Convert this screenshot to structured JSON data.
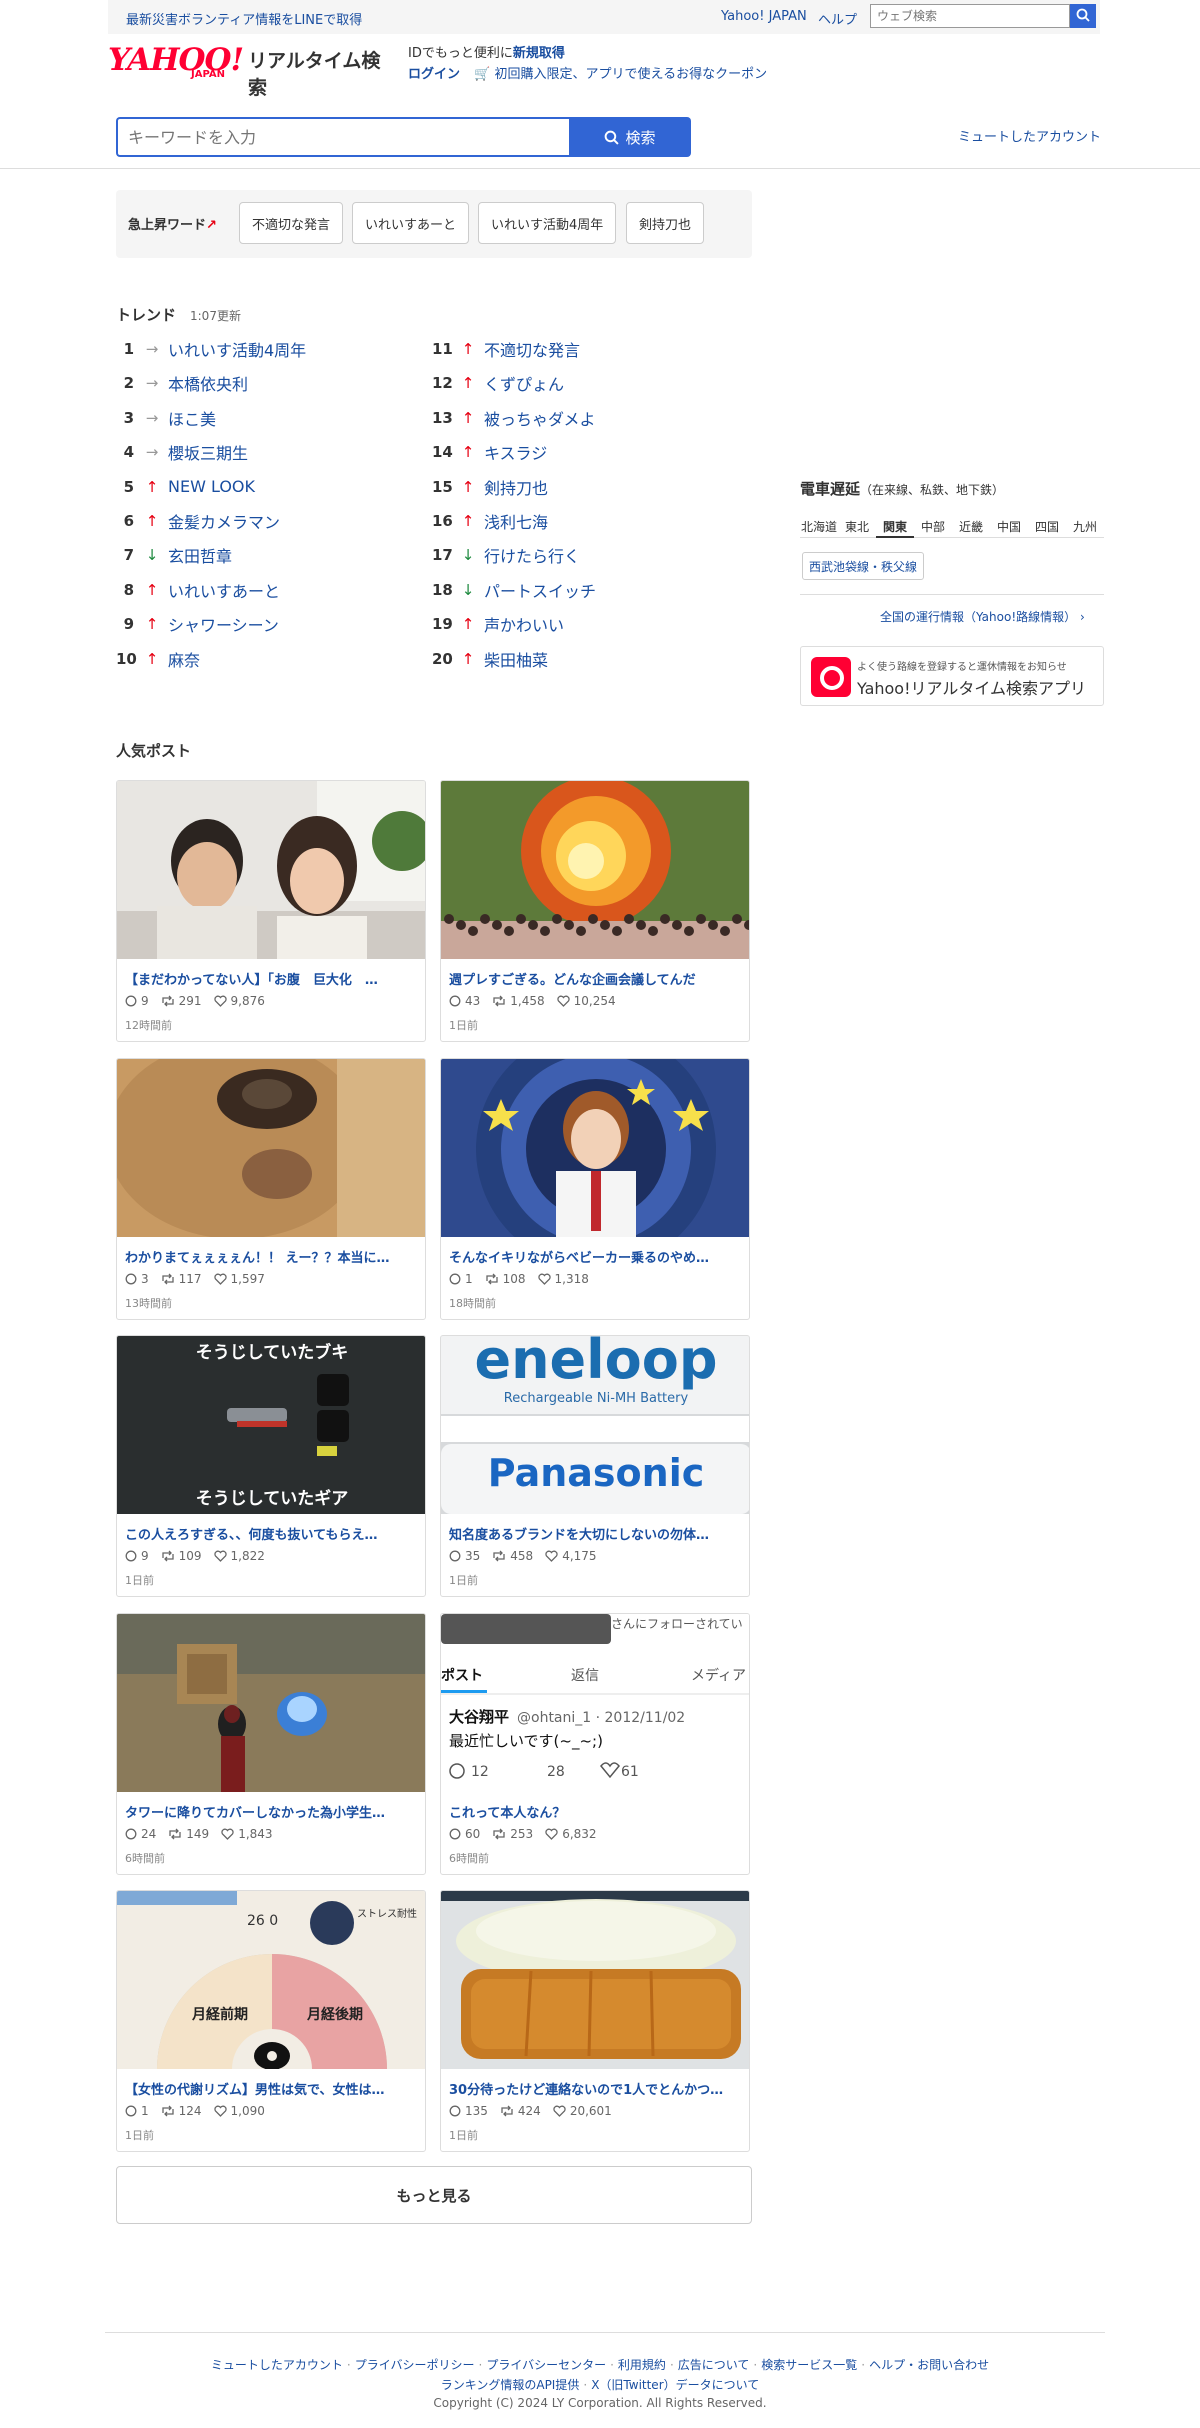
{
  "topbar": {
    "promo": "最新災害ボランティア情報をLINEで取得",
    "yahoo_japan": "Yahoo! JAPAN",
    "help": "ヘルプ",
    "web_search_placeholder": "ウェブ検索"
  },
  "header": {
    "logo_text": "YAHOO!",
    "logo_sub": "JAPAN",
    "service_name": "リアルタイム検索",
    "id_line_prefix": "IDでもっと便利に",
    "id_line_link": "新規取得",
    "login": "ログイン",
    "coupon": "初回購入限定、アプリで使えるお得なクーポン"
  },
  "search": {
    "placeholder": "キーワードを入力",
    "button": "検索",
    "muted_accounts": "ミュートしたアカウント"
  },
  "rising": {
    "label": "急上昇ワード",
    "words": [
      "不適切な発言",
      "いれいすあーと",
      "いれいす活動4周年",
      "剣持刀也"
    ]
  },
  "trend": {
    "title": "トレンド",
    "updated": "1:07更新",
    "items": [
      {
        "rank": "1",
        "dir": "flat",
        "word": "いれいす活動4周年"
      },
      {
        "rank": "2",
        "dir": "flat",
        "word": "本橋依央利"
      },
      {
        "rank": "3",
        "dir": "flat",
        "word": "ほこ美"
      },
      {
        "rank": "4",
        "dir": "flat",
        "word": "櫻坂三期生"
      },
      {
        "rank": "5",
        "dir": "up",
        "word": "NEW LOOK"
      },
      {
        "rank": "6",
        "dir": "up",
        "word": "金髪カメラマン"
      },
      {
        "rank": "7",
        "dir": "down",
        "word": "玄田哲章"
      },
      {
        "rank": "8",
        "dir": "up",
        "word": "いれいすあーと"
      },
      {
        "rank": "9",
        "dir": "up",
        "word": "シャワーシーン"
      },
      {
        "rank": "10",
        "dir": "up",
        "word": "麻奈"
      },
      {
        "rank": "11",
        "dir": "up",
        "word": "不適切な発言"
      },
      {
        "rank": "12",
        "dir": "up",
        "word": "くずぴょん"
      },
      {
        "rank": "13",
        "dir": "up",
        "word": "被っちゃダメよ"
      },
      {
        "rank": "14",
        "dir": "up",
        "word": "キスラジ"
      },
      {
        "rank": "15",
        "dir": "up",
        "word": "剣持刀也"
      },
      {
        "rank": "16",
        "dir": "up",
        "word": "浅利七海"
      },
      {
        "rank": "17",
        "dir": "down",
        "word": "行けたら行く"
      },
      {
        "rank": "18",
        "dir": "down",
        "word": "パートスイッチ"
      },
      {
        "rank": "19",
        "dir": "up",
        "word": "声かわいい"
      },
      {
        "rank": "20",
        "dir": "up",
        "word": "柴田柚菜"
      }
    ]
  },
  "train": {
    "title": "電車遅延",
    "subtitle": "（在来線、私鉄、地下鉄）",
    "regions": [
      "北海道",
      "東北",
      "関東",
      "中部",
      "近畿",
      "中国",
      "四国",
      "九州"
    ],
    "active_region": "関東",
    "line": "西武池袋線・秩父線",
    "nationwide": "全国の運行情報（Yahoo!路線情報） ›"
  },
  "app_banner": {
    "small": "よく使う路線を登録すると運休情報をお知らせ",
    "big": "Yahoo!リアルタイム検索アプリ"
  },
  "posts": {
    "title": "人気ポスト",
    "items": [
      {
        "title": "【まだわかってない人】「お腹　巨大化　…",
        "replies": "9",
        "reposts": "291",
        "likes": "9,876",
        "time": "12時間前",
        "img": "couple"
      },
      {
        "title": "週プレすごぎる。どんな企画会議してんだ",
        "replies": "43",
        "reposts": "1,458",
        "likes": "10,254",
        "time": "1日前",
        "img": "explosion"
      },
      {
        "title": "わかりまてぇぇぇぇん！！ えー？？本当に…",
        "replies": "3",
        "reposts": "117",
        "likes": "1,597",
        "time": "13時間前",
        "img": "dog"
      },
      {
        "title": "そんなイキリながらベビーカー乗るのやめ…",
        "replies": "1",
        "reposts": "108",
        "likes": "1,318",
        "time": "18時間前",
        "img": "anime"
      },
      {
        "title": "この人えろすぎる、、何度も抜いてもらえ…",
        "replies": "9",
        "reposts": "109",
        "likes": "1,822",
        "time": "1日前",
        "img": "game"
      },
      {
        "title": "知名度あるブランドを大切にしないの勿体…",
        "replies": "35",
        "reposts": "458",
        "likes": "4,175",
        "time": "1日前",
        "img": "battery"
      },
      {
        "title": "タワーに降りてカバーしなかった為小学生…",
        "replies": "24",
        "reposts": "149",
        "likes": "1,843",
        "time": "6時間前",
        "img": "fps"
      },
      {
        "title": "これって本人なん？",
        "replies": "60",
        "reposts": "253",
        "likes": "6,832",
        "time": "6時間前",
        "img": "tweet"
      },
      {
        "title": "【女性の代謝リズム】男性は気で、女性は…",
        "replies": "1",
        "reposts": "124",
        "likes": "1,090",
        "time": "1日前",
        "img": "rhythm"
      },
      {
        "title": "30分待ったけど連絡ないので1人でとんかつ…",
        "replies": "135",
        "reposts": "424",
        "likes": "20,601",
        "time": "1日前",
        "img": "tonkatsu"
      }
    ],
    "image_texts": {
      "game_top": "そうじしていたブキ",
      "game_bottom": "そうじしていたギア",
      "battery_brand": "eneloop",
      "battery_sub": "Rechargeable Ni-MH Battery",
      "battery_maker": "Panasonic",
      "tweet_follow": "さんにフォローされてい",
      "tweet_tab_post": "ポスト",
      "tweet_tab_reply": "返信",
      "tweet_tab_media": "メディア",
      "tweet_name": "大谷翔平",
      "tweet_handle": "@ohtani_1 · 2012/11/02",
      "tweet_text": "最近忙しいです(~_~;)",
      "tweet_r": "12",
      "tweet_rt": "28",
      "tweet_l": "61",
      "rhythm_top": "26 0",
      "rhythm_stress": "ストレス耐性",
      "rhythm_left1": "月経前期",
      "rhythm_left2": "月経後期"
    },
    "more": "もっと見る"
  },
  "footer": {
    "links1": [
      "ミュートしたアカウント",
      "プライバシーポリシー",
      "プライバシーセンター",
      "利用規約",
      "広告について",
      "検索サービス一覧",
      "ヘルプ・お問い合わせ"
    ],
    "links2": [
      "ランキング情報のAPI提供",
      "X（旧Twitter）データについて"
    ],
    "copyright": "Copyright (C) 2024 LY Corporation. All Rights Reserved."
  },
  "colors": {
    "accent": "#3165d4",
    "link": "#1a4ea0",
    "brand_red": "#ff0033",
    "up_red": "#e60012",
    "down_green": "#1d8a3e"
  }
}
